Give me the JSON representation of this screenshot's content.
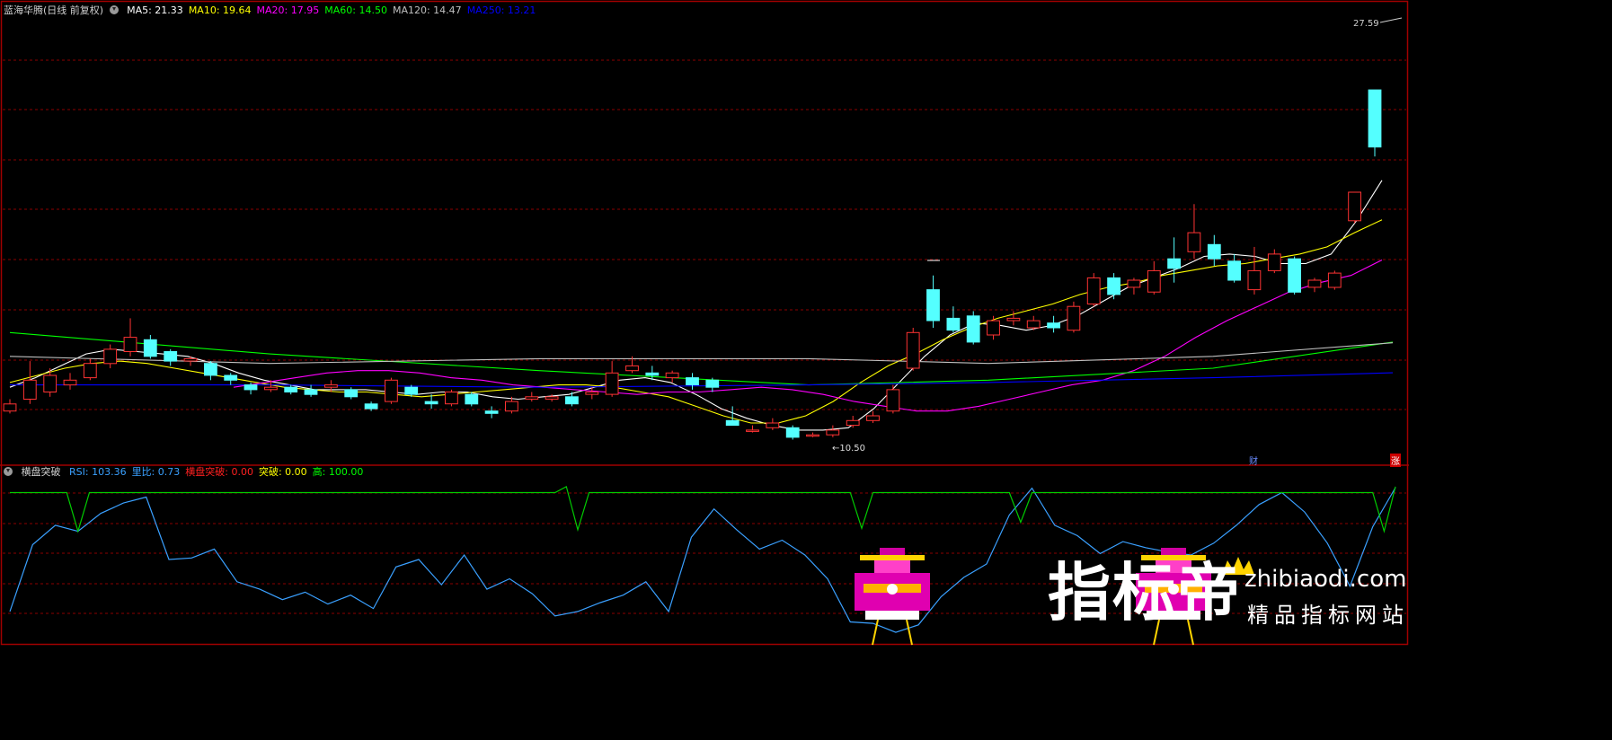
{
  "main_panel": {
    "title": "蓝海华腾(日线 前复权)",
    "ma_labels": [
      {
        "key": "ma5",
        "text": "MA5: 21.33",
        "color": "#ffffff"
      },
      {
        "key": "ma10",
        "text": "MA10: 19.64",
        "color": "#ffff00"
      },
      {
        "key": "ma20",
        "text": "MA20: 17.95",
        "color": "#ff00ff"
      },
      {
        "key": "ma60",
        "text": "MA60: 14.50",
        "color": "#00ff00"
      },
      {
        "key": "ma120",
        "text": "MA120: 14.47",
        "color": "#c0c0c0"
      },
      {
        "key": "ma250",
        "text": "MA250: 13.21",
        "color": "#0000ff"
      }
    ],
    "high_label": "27.59",
    "low_label": "←10.50",
    "markers": {
      "cai": "财",
      "zhang": "涨"
    }
  },
  "sub_panel": {
    "title": "横盘突破",
    "labels": [
      {
        "key": "rsi",
        "text": "RSI: 103.36",
        "color": "#3aa0ff"
      },
      {
        "key": "liangbi",
        "text": "里比: 0.73",
        "color": "#3aa0ff"
      },
      {
        "key": "hengpan",
        "text": "横盘突破: 0.00",
        "color": "#ff2020"
      },
      {
        "key": "tupo",
        "text": "突破: 0.00",
        "color": "#ffff00"
      },
      {
        "key": "gao",
        "text": "高: 100.00",
        "color": "#00ff00"
      }
    ]
  },
  "watermark": {
    "brand": "指标帝",
    "domain": "zhibiaodi.com",
    "slogan": "精品指标网站"
  },
  "colors": {
    "up": "#ff3333",
    "down": "#54ffff",
    "grid": "#8b0000",
    "frame": "#a00000"
  },
  "chart_data": [
    {
      "type": "candlestick",
      "title": "蓝海华腾(日线 前复权)",
      "ylim": [
        9.4,
        28.2
      ],
      "candles": [
        [
          11.6,
          11.9,
          12.1,
          11.5
        ],
        [
          12.1,
          12.9,
          13.7,
          11.9
        ],
        [
          12.4,
          13.1,
          13.4,
          12.2
        ],
        [
          12.7,
          12.9,
          13.2,
          12.5
        ],
        [
          13.0,
          13.6,
          13.8,
          12.9
        ],
        [
          13.6,
          14.2,
          14.4,
          13.4
        ],
        [
          14.1,
          14.7,
          15.5,
          13.9
        ],
        [
          14.6,
          13.9,
          14.8,
          13.8
        ],
        [
          14.1,
          13.7,
          14.2,
          13.5
        ],
        [
          13.7,
          13.8,
          13.9,
          13.5
        ],
        [
          13.6,
          13.1,
          13.7,
          12.9
        ],
        [
          13.1,
          12.9,
          13.2,
          12.7
        ],
        [
          12.7,
          12.5,
          12.8,
          12.3
        ],
        [
          12.5,
          12.6,
          12.9,
          12.4
        ],
        [
          12.6,
          12.4,
          12.7,
          12.3
        ],
        [
          12.5,
          12.3,
          12.7,
          12.2
        ],
        [
          12.6,
          12.7,
          12.9,
          12.4
        ],
        [
          12.5,
          12.2,
          12.6,
          12.1
        ],
        [
          11.9,
          11.7,
          12.0,
          11.6
        ],
        [
          12.0,
          12.9,
          13.0,
          11.9
        ],
        [
          12.6,
          12.3,
          12.7,
          12.2
        ],
        [
          12.0,
          11.9,
          12.3,
          11.7
        ],
        [
          11.9,
          12.4,
          12.5,
          11.8
        ],
        [
          12.3,
          11.9,
          12.4,
          11.8
        ],
        [
          11.6,
          11.5,
          11.8,
          11.3
        ],
        [
          11.6,
          12.0,
          12.2,
          11.5
        ],
        [
          12.1,
          12.2,
          12.4,
          12.0
        ],
        [
          12.1,
          12.2,
          12.3,
          12.0
        ],
        [
          12.2,
          11.9,
          12.4,
          11.8
        ],
        [
          12.3,
          12.4,
          12.6,
          12.1
        ],
        [
          12.3,
          13.2,
          13.7,
          12.2
        ],
        [
          13.3,
          13.5,
          13.9,
          13.2
        ],
        [
          13.2,
          13.1,
          13.5,
          12.9
        ],
        [
          13.0,
          13.2,
          13.3,
          12.8
        ],
        [
          13.0,
          12.7,
          13.2,
          12.5
        ],
        [
          12.9,
          12.6,
          13.0,
          12.4
        ],
        [
          11.2,
          11.0,
          11.8,
          11.0
        ],
        [
          10.8,
          10.8,
          11.0,
          10.7
        ],
        [
          10.9,
          11.1,
          11.3,
          10.8
        ],
        [
          10.9,
          10.5,
          11.0,
          10.4
        ],
        [
          10.6,
          10.6,
          10.7,
          10.5
        ],
        [
          10.6,
          10.8,
          11.0,
          10.5
        ],
        [
          11.0,
          11.2,
          11.4,
          10.9
        ],
        [
          11.2,
          11.4,
          11.6,
          11.1
        ],
        [
          11.6,
          12.5,
          12.7,
          11.5
        ],
        [
          13.4,
          14.9,
          15.1,
          13.3
        ],
        [
          16.7,
          15.4,
          17.3,
          15.1
        ],
        [
          15.5,
          15.0,
          16.0,
          14.9
        ],
        [
          15.6,
          14.5,
          15.8,
          14.4
        ],
        [
          14.8,
          15.4,
          15.6,
          14.6
        ],
        [
          15.4,
          15.5,
          15.8,
          15.2
        ],
        [
          15.1,
          15.4,
          15.6,
          15.0
        ],
        [
          15.3,
          15.1,
          15.6,
          14.9
        ],
        [
          15.0,
          16.0,
          16.2,
          14.9
        ],
        [
          16.1,
          17.2,
          17.4,
          16.0
        ],
        [
          17.2,
          16.5,
          17.4,
          16.3
        ],
        [
          16.8,
          17.1,
          17.2,
          16.5
        ],
        [
          16.6,
          17.5,
          17.9,
          16.5
        ],
        [
          18.0,
          17.6,
          18.9,
          17.0
        ],
        [
          18.3,
          19.1,
          20.3,
          18.0
        ],
        [
          18.6,
          18.0,
          19.0,
          17.7
        ],
        [
          17.9,
          17.1,
          18.2,
          17.0
        ],
        [
          16.7,
          17.5,
          18.5,
          16.5
        ],
        [
          17.5,
          18.2,
          18.4,
          17.4
        ],
        [
          18.0,
          16.6,
          18.1,
          16.5
        ],
        [
          16.8,
          17.1,
          17.2,
          16.6
        ],
        [
          16.8,
          17.4,
          17.5,
          16.7
        ],
        [
          19.6,
          20.8,
          20.8,
          19.5
        ],
        [
          25.1,
          22.7,
          25.1,
          22.3
        ]
      ],
      "ma_lines": {
        "MA5": [
          12.6,
          13.0,
          13.5,
          14.0,
          14.2,
          14.1,
          14.0,
          13.9,
          13.6,
          13.2,
          12.9,
          12.7,
          12.5,
          12.5,
          12.5,
          12.4,
          12.3,
          12.4,
          12.4,
          12.2,
          12.1,
          12.2,
          12.3,
          12.6,
          12.9,
          13.0,
          12.8,
          12.3,
          11.7,
          11.3,
          11.0,
          10.8,
          10.8,
          10.9,
          11.7,
          12.8,
          13.9,
          14.8,
          15.3,
          15.2,
          15.0,
          15.2,
          15.6,
          16.2,
          16.8,
          17.2,
          17.6,
          18.1,
          18.2,
          18.1,
          17.8,
          17.8,
          18.2,
          19.6,
          21.3
        ],
        "MA10": [
          12.8,
          13.1,
          13.4,
          13.6,
          13.7,
          13.6,
          13.4,
          13.2,
          13.0,
          12.8,
          12.6,
          12.5,
          12.4,
          12.4,
          12.3,
          12.2,
          12.3,
          12.4,
          12.5,
          12.6,
          12.7,
          12.7,
          12.6,
          12.4,
          12.2,
          11.8,
          11.4,
          11.1,
          11.1,
          11.4,
          12.0,
          12.8,
          13.5,
          14.0,
          14.6,
          15.1,
          15.5,
          15.8,
          16.1,
          16.5,
          16.8,
          17.0,
          17.3,
          17.5,
          17.7,
          17.8,
          18.0,
          18.2,
          18.5,
          19.1,
          19.64
        ],
        "MA20": [
          12.6,
          12.8,
          13.0,
          13.2,
          13.3,
          13.3,
          13.2,
          13.0,
          12.9,
          12.7,
          12.6,
          12.5,
          12.4,
          12.3,
          12.4,
          12.4,
          12.5,
          12.6,
          12.5,
          12.3,
          12.0,
          11.8,
          11.6,
          11.6,
          11.8,
          12.1,
          12.4,
          12.7,
          12.9,
          13.3,
          13.9,
          14.7,
          15.4,
          16.0,
          16.6,
          17.0,
          17.3,
          17.95
        ]
      }
    },
    {
      "type": "line",
      "title": "横盘突破",
      "ylim": [
        0,
        110
      ],
      "series": [
        {
          "name": "RSI",
          "values": [
            20,
            65,
            78,
            74,
            86,
            93,
            97,
            55,
            56,
            62,
            40,
            35,
            28,
            33,
            25,
            31,
            22,
            50,
            55,
            38,
            58,
            35,
            42,
            32,
            17,
            20,
            26,
            31,
            40,
            20,
            70,
            89,
            75,
            62,
            68,
            58,
            42,
            13,
            12,
            6,
            11,
            30,
            43,
            52,
            85,
            103,
            78,
            71,
            59,
            67,
            63,
            60,
            58,
            66,
            78,
            92,
            100,
            87,
            66,
            37,
            77,
            103.36
          ]
        },
        {
          "name": "高",
          "values": [
            100,
            100,
            100,
            100,
            100,
            100,
            74,
            100,
            100,
            100,
            100,
            100,
            100,
            100,
            100,
            100,
            100,
            100,
            100,
            100,
            100,
            100,
            100,
            100,
            100,
            100,
            100,
            100,
            100,
            100,
            100,
            100,
            100,
            100,
            100,
            100,
            100,
            100,
            100,
            100,
            100,
            100,
            100,
            100,
            100,
            100,
            100,
            100,
            100,
            104,
            75,
            100,
            100,
            100,
            100,
            100,
            100,
            100,
            100,
            100,
            100,
            100,
            100,
            100,
            100,
            100,
            100,
            100,
            100,
            100,
            100,
            100,
            100,
            100,
            100,
            76,
            100,
            100,
            100,
            100,
            100,
            100,
            100,
            100,
            100,
            100,
            100,
            100,
            100,
            80,
            100,
            100,
            100,
            100,
            100,
            100,
            100,
            100,
            100,
            100,
            100,
            100,
            100,
            100,
            100,
            100,
            100,
            100,
            100,
            100,
            100,
            100,
            100,
            100,
            100,
            100,
            100,
            100,
            100,
            100,
            100,
            74,
            104
          ]
        }
      ]
    }
  ]
}
